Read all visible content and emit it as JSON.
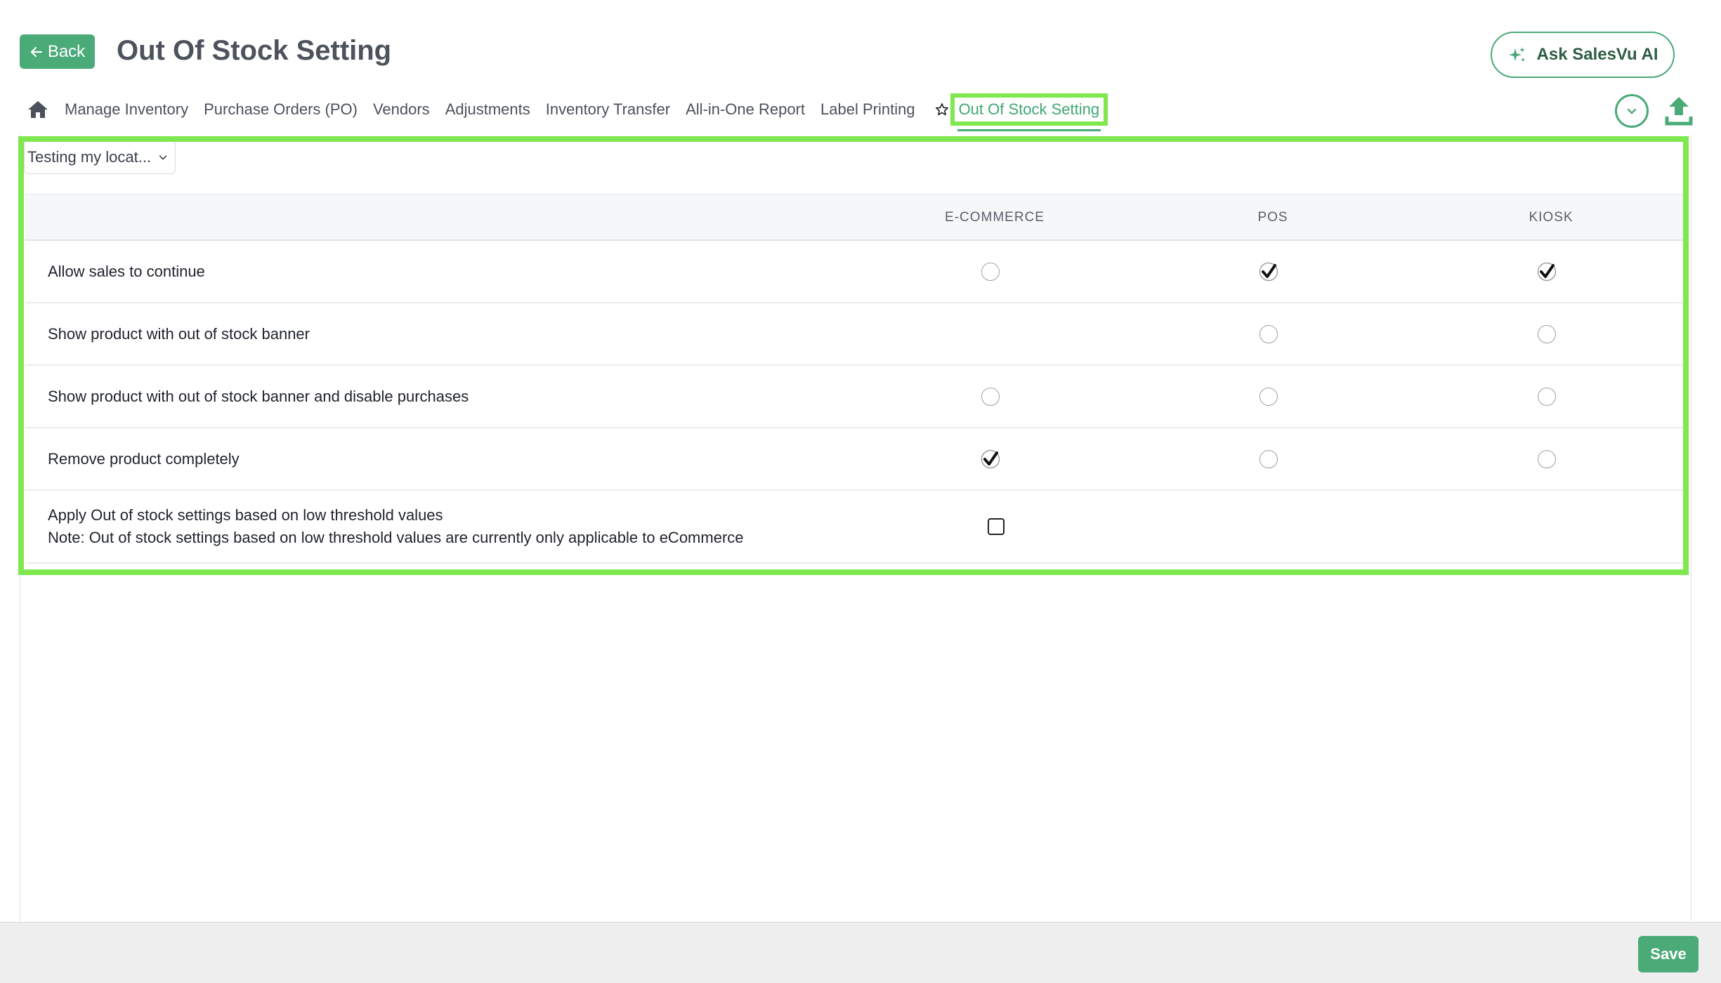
{
  "header": {
    "back_label": "Back",
    "title": "Out Of Stock Setting",
    "ask_ai_label": "Ask SalesVu AI"
  },
  "tabs": [
    {
      "label": "Manage Inventory"
    },
    {
      "label": "Purchase Orders (PO)"
    },
    {
      "label": "Vendors"
    },
    {
      "label": "Adjustments"
    },
    {
      "label": "Inventory Transfer"
    },
    {
      "label": "All-in-One Report"
    },
    {
      "label": "Label Printing"
    },
    {
      "label": "Out Of Stock Setting",
      "active": true
    }
  ],
  "location": {
    "selected": "Testing my locat..."
  },
  "table": {
    "columns": [
      "E-COMMERCE",
      "POS",
      "KIOSK"
    ],
    "rows": [
      {
        "label": "Allow sales to continue",
        "ecommerce": "unchecked",
        "pos": "checked",
        "kiosk": "checked"
      },
      {
        "label": "Show product with out of stock banner",
        "ecommerce": "none",
        "pos": "unchecked",
        "kiosk": "unchecked"
      },
      {
        "label": "Show product with out of stock banner and disable purchases",
        "ecommerce": "unchecked",
        "pos": "unchecked",
        "kiosk": "unchecked"
      },
      {
        "label": "Remove product completely",
        "ecommerce": "checked",
        "pos": "unchecked",
        "kiosk": "unchecked"
      }
    ],
    "threshold": {
      "label": "Apply Out of stock settings based on low threshold values",
      "note": "Note: Out of stock settings based on low threshold values are currently only applicable to eCommerce",
      "checked": false
    }
  },
  "footer": {
    "save_label": "Save"
  },
  "colors": {
    "accent": "#4aaa78",
    "highlight": "#7ee84e"
  },
  "icons": [
    "arrow-left-icon",
    "sparkle-icon",
    "home-icon",
    "star-icon",
    "chevron-down-icon",
    "upload-icon"
  ]
}
